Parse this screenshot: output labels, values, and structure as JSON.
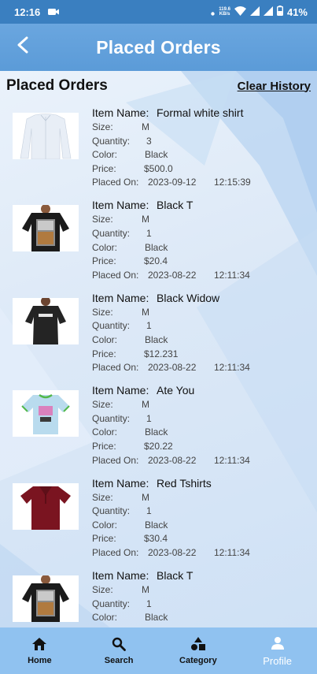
{
  "status_bar": {
    "time": "12:16",
    "net_speed_value": "119.6",
    "net_speed_unit": "KB/s",
    "battery": "41%"
  },
  "app_bar": {
    "title": "Placed Orders"
  },
  "section": {
    "title": "Placed Orders",
    "clear_label": "Clear History"
  },
  "labels": {
    "item_name": "Item Name:",
    "size": "Size:",
    "quantity": "Quantity:",
    "color": "Color:",
    "price": "Price:",
    "placed_on": "Placed On:"
  },
  "orders": [
    {
      "item_name": "Formal white shirt",
      "size": "M",
      "quantity": "3",
      "color": "Black",
      "price": "$500.0",
      "date": "2023-09-12",
      "time": "12:15:39",
      "image": "white-shirt"
    },
    {
      "item_name": "Black T",
      "size": "M",
      "quantity": "1",
      "color": "Black",
      "price": "$20.4",
      "date": "2023-08-22",
      "time": "12:11:34",
      "image": "black-tshirt-print"
    },
    {
      "item_name": "Black Widow",
      "size": "M",
      "quantity": "1",
      "color": "Black",
      "price": "$12.231",
      "date": "2023-08-22",
      "time": "12:11:34",
      "image": "black-womens-tshirt"
    },
    {
      "item_name": "Ate You",
      "size": "M",
      "quantity": "1",
      "color": "Black",
      "price": "$20.22",
      "date": "2023-08-22",
      "time": "12:11:34",
      "image": "kids-light-blue-tshirt"
    },
    {
      "item_name": "Red Tshirts",
      "size": "M",
      "quantity": "1",
      "color": "Black",
      "price": "$30.4",
      "date": "2023-08-22",
      "time": "12:11:34",
      "image": "maroon-polo"
    },
    {
      "item_name": "Black T",
      "size": "M",
      "quantity": "1",
      "color": "Black",
      "price": "",
      "date": "",
      "time": "",
      "image": "black-tshirt-print"
    }
  ],
  "bottom_nav": [
    {
      "label": "Home",
      "icon": "home-icon"
    },
    {
      "label": "Search",
      "icon": "search-icon"
    },
    {
      "label": "Category",
      "icon": "category-icon"
    },
    {
      "label": "Profile",
      "icon": "person-icon",
      "active": true
    }
  ]
}
